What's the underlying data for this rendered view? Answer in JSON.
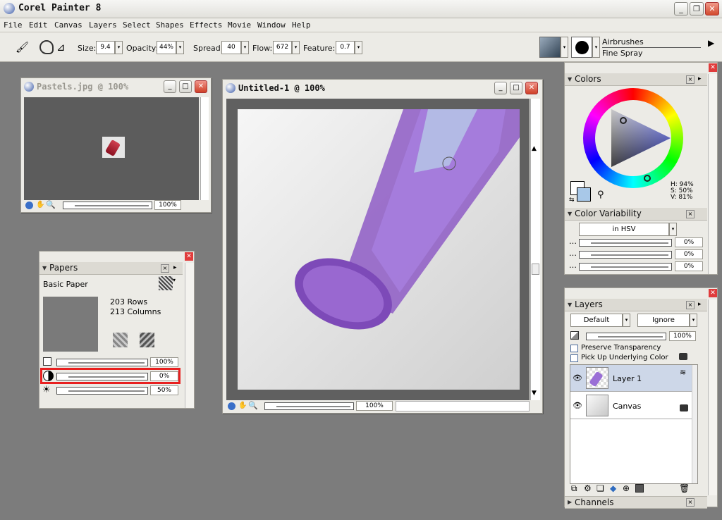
{
  "app": {
    "title": "Corel Painter 8"
  },
  "menu": [
    "File",
    "Edit",
    "Canvas",
    "Layers",
    "Select",
    "Shapes",
    "Effects",
    "Movie",
    "Window",
    "Help"
  ],
  "propbar": {
    "size_label": "Size:",
    "size_value": "9.4",
    "opacity_label": "Opacity:",
    "opacity_value": "44%",
    "spread_label": "Spread:",
    "spread_value": "40",
    "flow_label": "Flow:",
    "flow_value": "672",
    "feature_label": "Feature:",
    "feature_value": "0.7",
    "brush_category": "Airbrushes",
    "brush_variant": "Fine Spray"
  },
  "pastels_doc": {
    "title": "Pastels.jpg @ 100%",
    "zoom": "100%"
  },
  "main_doc": {
    "title": "Untitled-1 @ 100%",
    "zoom": "100%"
  },
  "papers": {
    "title": "Papers",
    "paper_name": "Basic Paper",
    "rows": "203 Rows",
    "columns": "213 Columns",
    "scale": "100%",
    "contrast": "0%",
    "brightness": "50%"
  },
  "colors": {
    "title": "Colors",
    "h": "H: 94%",
    "s": "S: 50%",
    "v": "V: 81%",
    "accent": "#c27ee8"
  },
  "color_variability": {
    "title": "Color Variability",
    "mode": "in HSV",
    "v1": "0%",
    "v2": "0%",
    "v3": "0%"
  },
  "layers": {
    "title": "Layers",
    "composite_method": "Default",
    "composite_depth": "Ignore",
    "opacity": "100%",
    "preserve_transparency": "Preserve Transparency",
    "pick_up_color": "Pick Up Underlying Color",
    "items": [
      {
        "name": "Layer 1"
      },
      {
        "name": "Canvas"
      }
    ]
  },
  "channels": {
    "title": "Channels"
  }
}
